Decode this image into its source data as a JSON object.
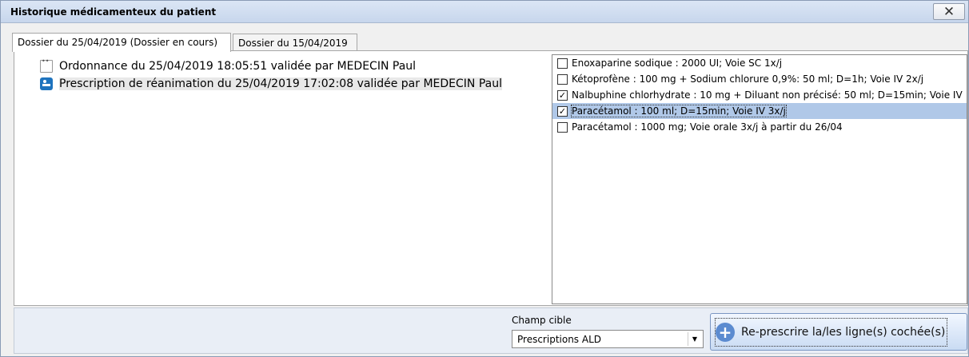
{
  "window": {
    "title": "Historique médicamenteux du patient",
    "close_label": "✕"
  },
  "tabs": [
    {
      "label": "Dossier du 25/04/2019 (Dossier en cours)",
      "active": true
    },
    {
      "label": "Dossier du 15/04/2019",
      "active": false
    }
  ],
  "tree": [
    {
      "label": "Ordonnance du 25/04/2019 18:05:51 validée par MEDECIN Paul",
      "icon": "document-icon"
    },
    {
      "label": "Prescription de réanimation du 25/04/2019 17:02:08 validée par MEDECIN Paul",
      "icon": "hospital-bed-icon",
      "selected": true
    }
  ],
  "drugs": [
    {
      "label": "Enoxaparine sodique : 2000 UI; Voie SC 1x/j",
      "checked": false
    },
    {
      "label": "Kétoprofène : 100 mg + Sodium chlorure 0,9%: 50 ml; D=1h; Voie IV 2x/j",
      "checked": false
    },
    {
      "label": "Nalbuphine chlorhydrate : 10 mg + Diluant non précisé: 50 ml; D=15min; Voie IV",
      "checked": true
    },
    {
      "label": "Paracétamol : 100 ml; D=15min; Voie IV 3x/j",
      "checked": true,
      "selected": true
    },
    {
      "label": "Paracétamol : 1000 mg; Voie orale 3x/j à partir du 26/04",
      "checked": false
    }
  ],
  "target": {
    "label": "Champ cible",
    "selected": "Prescriptions ALD"
  },
  "action": {
    "label": "Re-prescrire la/les ligne(s) cochée(s)",
    "icon": "plus-circle-icon"
  },
  "colors": {
    "selection": "#b0c8e8",
    "button_icon": "#5b8bd0",
    "bed_icon": "#1e73be"
  }
}
